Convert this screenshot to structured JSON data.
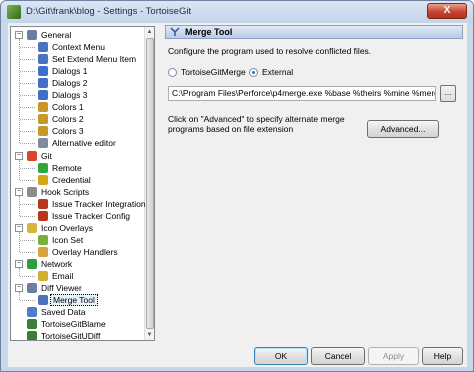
{
  "window": {
    "title": "D:\\Git\\frank\\blog - Settings - TortoiseGit",
    "close_label": "X"
  },
  "tree": {
    "items": [
      {
        "label": "General",
        "icon": "wrench-icon",
        "color": "#6c7fa3"
      },
      {
        "label": "Context Menu",
        "icon": "menu-icon",
        "color": "#4a73c2"
      },
      {
        "label": "Set Extend Menu Item",
        "icon": "menu-icon",
        "color": "#4a73c2"
      },
      {
        "label": "Dialogs 1",
        "icon": "dialog-icon",
        "color": "#3f6fc9"
      },
      {
        "label": "Dialogs 2",
        "icon": "dialog-icon",
        "color": "#3f6fc9"
      },
      {
        "label": "Dialogs 3",
        "icon": "dialog-icon",
        "color": "#3f6fc9"
      },
      {
        "label": "Colors 1",
        "icon": "palette-icon",
        "color": "#c8972a"
      },
      {
        "label": "Colors 2",
        "icon": "palette-icon",
        "color": "#c8972a"
      },
      {
        "label": "Colors 3",
        "icon": "palette-icon",
        "color": "#c8972a"
      },
      {
        "label": "Alternative editor",
        "icon": "editor-icon",
        "color": "#7e8c9e"
      },
      {
        "label": "Git",
        "icon": "git-icon",
        "color": "#d9472b"
      },
      {
        "label": "Remote",
        "icon": "remote-icon",
        "color": "#2fa83a"
      },
      {
        "label": "Credential",
        "icon": "key-icon",
        "color": "#d4a419"
      },
      {
        "label": "Hook Scripts",
        "icon": "hook-icon",
        "color": "#8c8c8c"
      },
      {
        "label": "Issue Tracker Integration",
        "icon": "bug-icon",
        "color": "#b8381f"
      },
      {
        "label": "Issue Tracker Config",
        "icon": "bug-icon",
        "color": "#b8381f"
      },
      {
        "label": "Icon Overlays",
        "icon": "overlay-icon",
        "color": "#d7b43a"
      },
      {
        "label": "Icon Set",
        "icon": "iconset-icon",
        "color": "#7ab03a"
      },
      {
        "label": "Overlay Handlers",
        "icon": "handler-icon",
        "color": "#d7a53a"
      },
      {
        "label": "Network",
        "icon": "network-icon",
        "color": "#2f9e3d"
      },
      {
        "label": "Email",
        "icon": "email-icon",
        "color": "#d4ad2e"
      },
      {
        "label": "Diff Viewer",
        "icon": "magnifier-icon",
        "color": "#6c7fa3"
      },
      {
        "label": "Merge Tool",
        "icon": "merge-icon",
        "color": "#4c73b8"
      },
      {
        "label": "Saved Data",
        "icon": "saved-data-icon",
        "color": "#4a7ec9"
      },
      {
        "label": "TortoiseGitBlame",
        "icon": "blame-icon",
        "color": "#3c7d3a"
      },
      {
        "label": "TortoiseGitUDiff",
        "icon": "udiff-icon",
        "color": "#3c7d3a"
      }
    ]
  },
  "panel": {
    "header": "Merge Tool",
    "description": "Configure the program used to resolve conflicted files.",
    "radio_tortoise": "TortoiseGitMerge",
    "radio_external": "External",
    "path_value": "C:\\Program Files\\Perforce\\p4merge.exe %base %theirs %mine %merged",
    "browse_label": "...",
    "note": "Click on \"Advanced\" to specify alternate merge programs based on file extension",
    "advanced_label": "Advanced..."
  },
  "buttons": {
    "ok": "OK",
    "cancel": "Cancel",
    "apply": "Apply",
    "help": "Help"
  }
}
